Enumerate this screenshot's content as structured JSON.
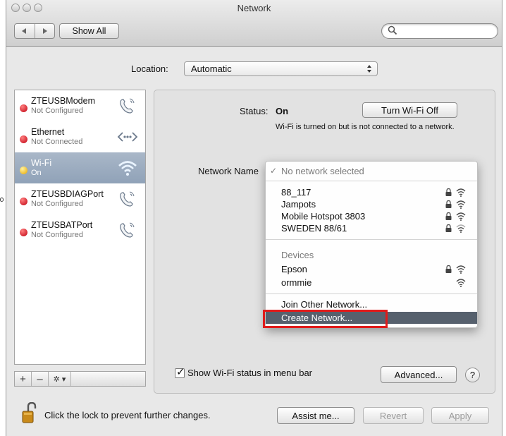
{
  "window": {
    "title": "Network"
  },
  "toolbar": {
    "show_all_label": "Show All",
    "search_placeholder": ""
  },
  "location": {
    "label": "Location:",
    "value": "Automatic"
  },
  "sidebar": {
    "items": [
      {
        "name": "ZTEUSBModem",
        "status": "Not Configured",
        "dot_color": "#d0021b",
        "icon": "phone-icon"
      },
      {
        "name": "Ethernet",
        "status": "Not Connected",
        "dot_color": "#d0021b",
        "icon": "ethernet-icon"
      },
      {
        "name": "Wi-Fi",
        "status": "On",
        "dot_color": "#f5b800",
        "icon": "wifi-icon",
        "selected": true
      },
      {
        "name": "ZTEUSBDIAGPort",
        "status": "Not Configured",
        "dot_color": "#d0021b",
        "icon": "phone-icon"
      },
      {
        "name": "ZTEUSBATPort",
        "status": "Not Configured",
        "dot_color": "#d0021b",
        "icon": "phone-icon"
      }
    ],
    "footer": {
      "add": "+",
      "remove": "–",
      "action": "✲ ▾"
    }
  },
  "main": {
    "status_label": "Status:",
    "status_value": "On",
    "status_description": "Wi-Fi is turned on but is not connected to a network.",
    "turn_off_button": "Turn Wi-Fi Off",
    "network_name_label": "Network Name",
    "show_wifi_status_label": "Show Wi-Fi status in menu bar",
    "show_wifi_status_checked": true,
    "advanced_button": "Advanced...",
    "help_button": "?"
  },
  "network_menu": {
    "no_network": "No network selected",
    "networks": [
      {
        "name": "88_117",
        "locked": true
      },
      {
        "name": "Jampots",
        "locked": true
      },
      {
        "name": "Mobile Hotspot 3803",
        "locked": true
      },
      {
        "name": "SWEDEN 88/61",
        "locked": true
      }
    ],
    "devices_header": "Devices",
    "devices": [
      {
        "name": "Epson",
        "locked": true
      },
      {
        "name": "ormmie",
        "locked": false
      }
    ],
    "join_other": "Join Other Network...",
    "create_network": "Create Network..."
  },
  "footer": {
    "lock_text": "Click the lock to prevent further changes.",
    "assist_button": "Assist me...",
    "revert_button": "Revert",
    "apply_button": "Apply"
  },
  "colors": {
    "selection": "#56606d",
    "highlight_box": "#e01b1b",
    "sidebar_selected": "#9fb0c4"
  }
}
